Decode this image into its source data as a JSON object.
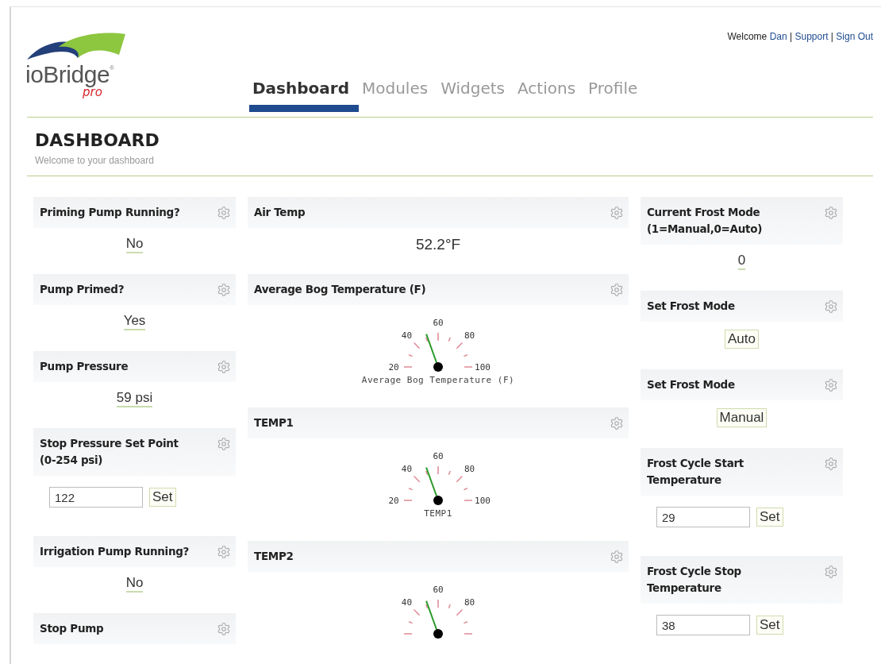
{
  "logo": {
    "name": "ioBridge",
    "mark": "®",
    "edition": "pro"
  },
  "user_bar": {
    "greeting": "Welcome",
    "user": "Dan",
    "separator": "|",
    "links": [
      "Support",
      "Sign Out"
    ]
  },
  "tabs": [
    {
      "label": "Dashboard",
      "selected": true
    },
    {
      "label": "Modules",
      "selected": false
    },
    {
      "label": "Widgets",
      "selected": false
    },
    {
      "label": "Actions",
      "selected": false
    },
    {
      "label": "Profile",
      "selected": false
    }
  ],
  "page": {
    "title": "DASHBOARD",
    "subtitle": "Welcome to your dashboard"
  },
  "columns": [
    {
      "widgets": [
        {
          "kind": "value",
          "title": "Priming Pump Running?",
          "value": "No"
        },
        {
          "kind": "value",
          "title": "Pump Primed?",
          "value": "Yes"
        },
        {
          "kind": "value",
          "title": "Pump Pressure",
          "value": "59 psi"
        },
        {
          "kind": "input",
          "title": "Stop Pressure Set Point (0-254 psi)",
          "value": "122",
          "button": "Set"
        },
        {
          "kind": "value",
          "title": "Irrigation Pump Running?",
          "value": "No"
        },
        {
          "title": "Stop Pump"
        }
      ]
    },
    {
      "widgets": [
        {
          "kind": "reading",
          "title": "Air Temp",
          "value": "52.2°F"
        },
        {
          "kind": "gauge",
          "title": "Average Bog Temperature (F)",
          "ticks": [
            "20",
            "40",
            "60",
            "80",
            "100"
          ],
          "level": 0.39,
          "caption": "Average Bog Temperature (F)"
        },
        {
          "kind": "gauge",
          "title": "TEMP1",
          "ticks": [
            "20",
            "40",
            "60",
            "80",
            "100"
          ],
          "level": 0.39,
          "caption": "TEMP1"
        },
        {
          "kind": "gauge",
          "title": "TEMP2",
          "ticks": [
            "40",
            "60",
            "80"
          ],
          "level": 0.39
        }
      ]
    },
    {
      "widgets": [
        {
          "kind": "value",
          "title": "Current Frost Mode (1=Manual,0=Auto)",
          "value": "0"
        },
        {
          "kind": "button",
          "title": "Set Frost Mode",
          "button": "Auto"
        },
        {
          "kind": "button",
          "title": "Set Frost Mode",
          "button": "Manual"
        },
        {
          "kind": "input",
          "title": "Frost Cycle Start Temperature",
          "value": "29",
          "button": "Set"
        },
        {
          "kind": "input",
          "title": "Frost Cycle Stop Temperature",
          "value": "38",
          "button": "Set"
        }
      ]
    }
  ]
}
